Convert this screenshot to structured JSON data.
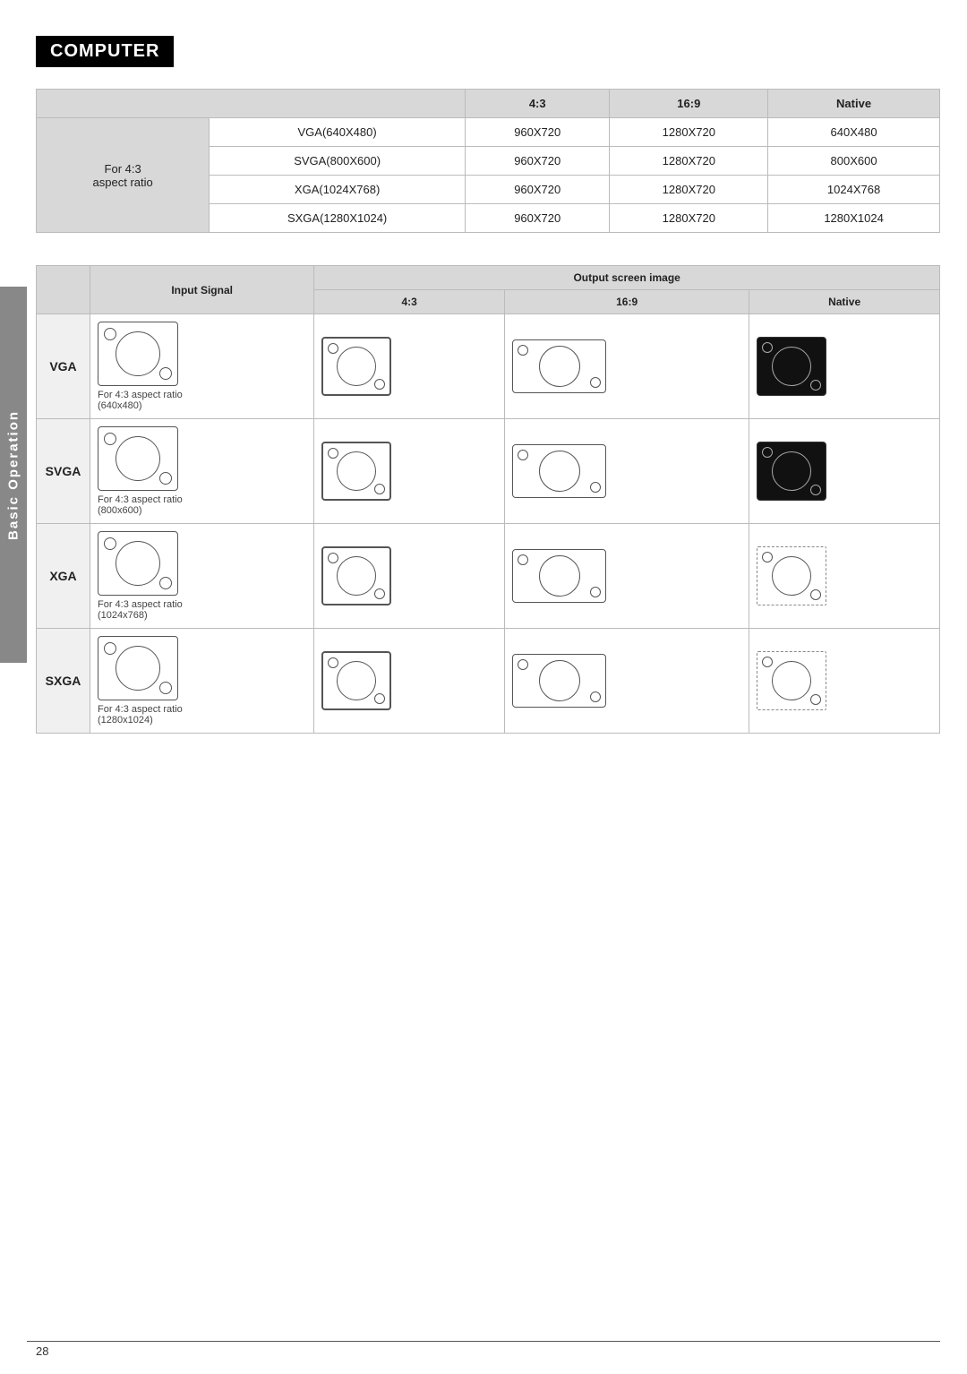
{
  "heading": "COMPUTER",
  "side_tab": "Basic Operation",
  "page_number": "28",
  "top_table": {
    "headers": [
      "",
      "",
      "4:3",
      "16:9",
      "Native"
    ],
    "row_label": "For 4:3\naspect ratio",
    "rows": [
      {
        "signal": "VGA(640X480)",
        "ratio43": "960X720",
        "ratio169": "1280X720",
        "native": "640X480"
      },
      {
        "signal": "SVGA(800X600)",
        "ratio43": "960X720",
        "ratio169": "1280X720",
        "native": "800X600"
      },
      {
        "signal": "XGA(1024X768)",
        "ratio43": "960X720",
        "ratio169": "1280X720",
        "native": "1024X768"
      },
      {
        "signal": "SXGA(1280X1024)",
        "ratio43": "960X720",
        "ratio169": "1280X720",
        "native": "1280X1024"
      }
    ]
  },
  "visual_table": {
    "output_header": "Output screen image",
    "col_input_signal": "Input Signal",
    "col_43": "4:3",
    "col_169": "16:9",
    "col_native": "Native",
    "rows": [
      {
        "label": "VGA",
        "signal_label": "For 4:3 aspect ratio\n(640x480)",
        "native_type": "black"
      },
      {
        "label": "SVGA",
        "signal_label": "For 4:3 aspect ratio\n(800x600)",
        "native_type": "black"
      },
      {
        "label": "XGA",
        "signal_label": "For 4:3 aspect ratio\n(1024x768)",
        "native_type": "dot"
      },
      {
        "label": "SXGA",
        "signal_label": "For 4:3 aspect ratio\n(1280x1024)",
        "native_type": "dot"
      }
    ]
  }
}
